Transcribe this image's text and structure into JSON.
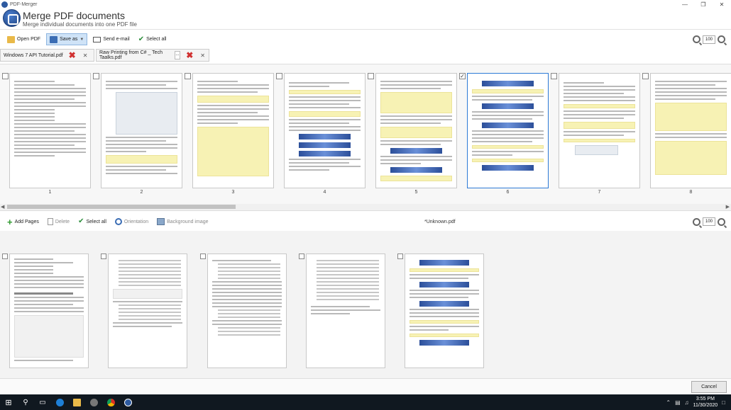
{
  "window": {
    "title": "PDF-Merger",
    "controls": [
      "minimize-icon",
      "maximize-icon",
      "close-icon"
    ]
  },
  "header": {
    "title": "Merge PDF documents",
    "subtitle": "Merge individual documents into one PDF file"
  },
  "toolbar": {
    "open_pdf": "Open PDF",
    "save_as": "Save as",
    "send_email": "Send e-mail",
    "select_all": "Select all",
    "zoom": "100"
  },
  "tabs": [
    {
      "label": "Windows 7 API Tutorial.pdf"
    },
    {
      "label": "Raw Printing from C# _ Tech Taalks.pdf",
      "more": "..."
    }
  ],
  "pages": {
    "numbers": [
      "1",
      "2",
      "3",
      "4",
      "5",
      "6",
      "7",
      "8"
    ],
    "selected": 6,
    "checked": 6
  },
  "toolbar2": {
    "add_pages": "Add Pages",
    "delete": "Delete",
    "select_all": "Select all",
    "orientation": "Orientation",
    "background_image": "Background image",
    "filename": "*Unknown.pdf",
    "zoom": "100"
  },
  "footer": {
    "cancel": "Cancel"
  },
  "taskbar": {
    "time": "3:55 PM",
    "date": "11/30/2020"
  },
  "colors": {
    "accent": "#2d7ad6",
    "highlight": "#f7f2b4",
    "taskbar": "#101820"
  }
}
